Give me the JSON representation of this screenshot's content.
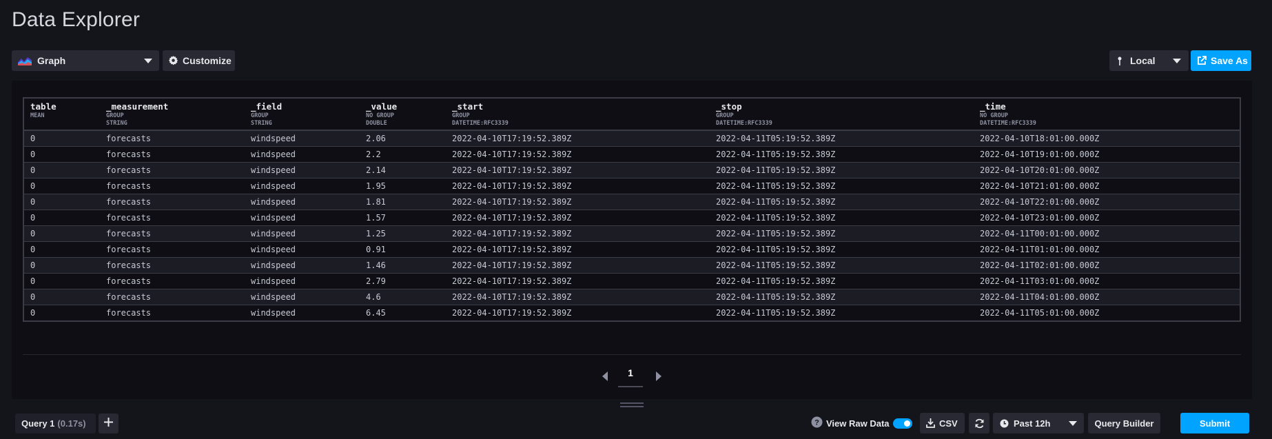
{
  "page": {
    "title": "Data Explorer"
  },
  "toolbar": {
    "graph_label": "Graph",
    "customize_label": "Customize",
    "local_label": "Local",
    "save_as_label": "Save As"
  },
  "table": {
    "columns": [
      {
        "name": "table",
        "sub1": "MEAN",
        "sub2": ""
      },
      {
        "name": "_measurement",
        "sub1": "GROUP",
        "sub2": "STRING"
      },
      {
        "name": "_field",
        "sub1": "GROUP",
        "sub2": "STRING"
      },
      {
        "name": "_value",
        "sub1": "NO GROUP",
        "sub2": "DOUBLE"
      },
      {
        "name": "_start",
        "sub1": "GROUP",
        "sub2": "DATETIME:RFC3339"
      },
      {
        "name": "_stop",
        "sub1": "GROUP",
        "sub2": "DATETIME:RFC3339"
      },
      {
        "name": "_time",
        "sub1": "NO GROUP",
        "sub2": "DATETIME:RFC3339"
      }
    ],
    "rows": [
      [
        "0",
        "forecasts",
        "windspeed",
        "2.06",
        "2022-04-10T17:19:52.389Z",
        "2022-04-11T05:19:52.389Z",
        "2022-04-10T18:01:00.000Z"
      ],
      [
        "0",
        "forecasts",
        "windspeed",
        "2.2",
        "2022-04-10T17:19:52.389Z",
        "2022-04-11T05:19:52.389Z",
        "2022-04-10T19:01:00.000Z"
      ],
      [
        "0",
        "forecasts",
        "windspeed",
        "2.14",
        "2022-04-10T17:19:52.389Z",
        "2022-04-11T05:19:52.389Z",
        "2022-04-10T20:01:00.000Z"
      ],
      [
        "0",
        "forecasts",
        "windspeed",
        "1.95",
        "2022-04-10T17:19:52.389Z",
        "2022-04-11T05:19:52.389Z",
        "2022-04-10T21:01:00.000Z"
      ],
      [
        "0",
        "forecasts",
        "windspeed",
        "1.81",
        "2022-04-10T17:19:52.389Z",
        "2022-04-11T05:19:52.389Z",
        "2022-04-10T22:01:00.000Z"
      ],
      [
        "0",
        "forecasts",
        "windspeed",
        "1.57",
        "2022-04-10T17:19:52.389Z",
        "2022-04-11T05:19:52.389Z",
        "2022-04-10T23:01:00.000Z"
      ],
      [
        "0",
        "forecasts",
        "windspeed",
        "1.25",
        "2022-04-10T17:19:52.389Z",
        "2022-04-11T05:19:52.389Z",
        "2022-04-11T00:01:00.000Z"
      ],
      [
        "0",
        "forecasts",
        "windspeed",
        "0.91",
        "2022-04-10T17:19:52.389Z",
        "2022-04-11T05:19:52.389Z",
        "2022-04-11T01:01:00.000Z"
      ],
      [
        "0",
        "forecasts",
        "windspeed",
        "1.46",
        "2022-04-10T17:19:52.389Z",
        "2022-04-11T05:19:52.389Z",
        "2022-04-11T02:01:00.000Z"
      ],
      [
        "0",
        "forecasts",
        "windspeed",
        "2.79",
        "2022-04-10T17:19:52.389Z",
        "2022-04-11T05:19:52.389Z",
        "2022-04-11T03:01:00.000Z"
      ],
      [
        "0",
        "forecasts",
        "windspeed",
        "4.6",
        "2022-04-10T17:19:52.389Z",
        "2022-04-11T05:19:52.389Z",
        "2022-04-11T04:01:00.000Z"
      ],
      [
        "0",
        "forecasts",
        "windspeed",
        "6.45",
        "2022-04-10T17:19:52.389Z",
        "2022-04-11T05:19:52.389Z",
        "2022-04-11T05:01:00.000Z"
      ]
    ]
  },
  "pagination": {
    "current_page": "1"
  },
  "bottom": {
    "query_tab_label": "Query 1",
    "query_time": "(0.17s)",
    "view_raw_label": "View Raw Data",
    "view_raw_on": true,
    "csv_label": "CSV",
    "range_label": "Past 12h",
    "query_builder_label": "Query Builder",
    "submit_label": "Submit"
  },
  "colors": {
    "accent": "#00a3ff",
    "background": "#14151b",
    "panel": "#0f0e15"
  },
  "icons": {
    "graph": "graph-type-icon",
    "customize": "gear-icon",
    "local": "pin-icon",
    "save_as": "external-link-icon",
    "help": "question-icon",
    "csv": "download-icon",
    "refresh": "refresh-icon",
    "range": "clock-icon",
    "add": "plus-icon"
  }
}
